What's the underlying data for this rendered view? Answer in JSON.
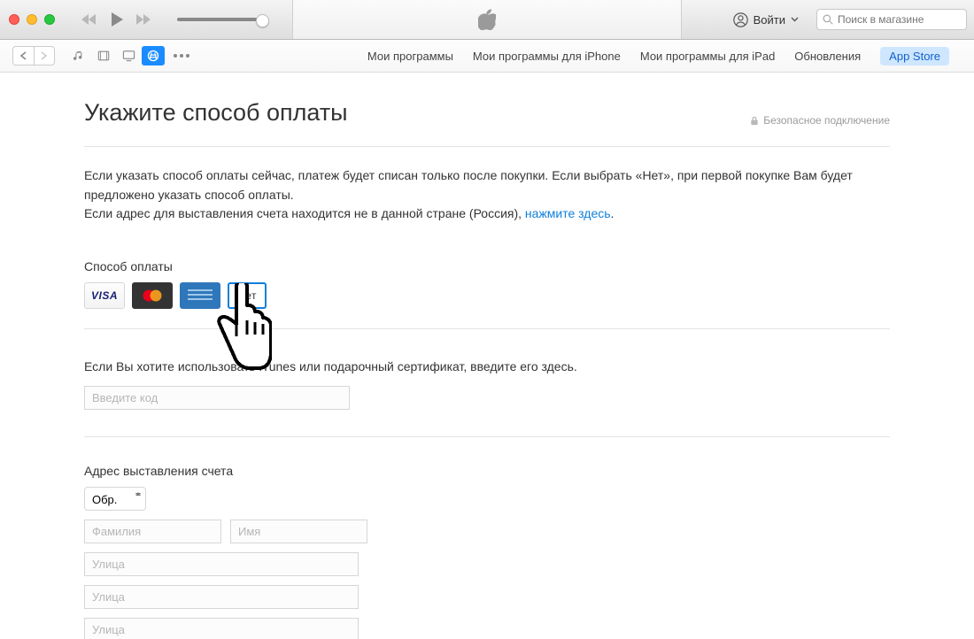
{
  "titlebar": {
    "signin_label": "Войти",
    "search_placeholder": "Поиск в магазине"
  },
  "toolbar": {
    "tabs": [
      "Мои программы",
      "Мои программы для iPhone",
      "Мои программы для iPad",
      "Обновления",
      "App Store"
    ]
  },
  "page": {
    "title": "Укажите способ оплаты",
    "secure": "Безопасное подключение",
    "desc1": "Если указать способ оплаты сейчас, платеж будет списан только после покупки. Если выбрать «Нет», при первой покупке Вам будет предложено указать способ оплаты.",
    "desc2_pre": "Если адрес для выставления счета находится не в данной стране (Россия), ",
    "desc2_link": "нажмите здесь",
    "desc2_post": ".",
    "payment_label": "Способ оплаты",
    "payment_options": {
      "visa": "VISA",
      "mc": "MasterCard",
      "amex": "AMEX",
      "none": "Нет"
    },
    "gift_text": "Если Вы хотите использовать iTunes или подарочный сертификат, введите его здесь.",
    "code_placeholder": "Введите код",
    "billing_label": "Адрес выставления счета",
    "salutation": "Обр.",
    "placeholders": {
      "lastname": "Фамилия",
      "firstname": "Имя",
      "street": "Улица"
    }
  }
}
